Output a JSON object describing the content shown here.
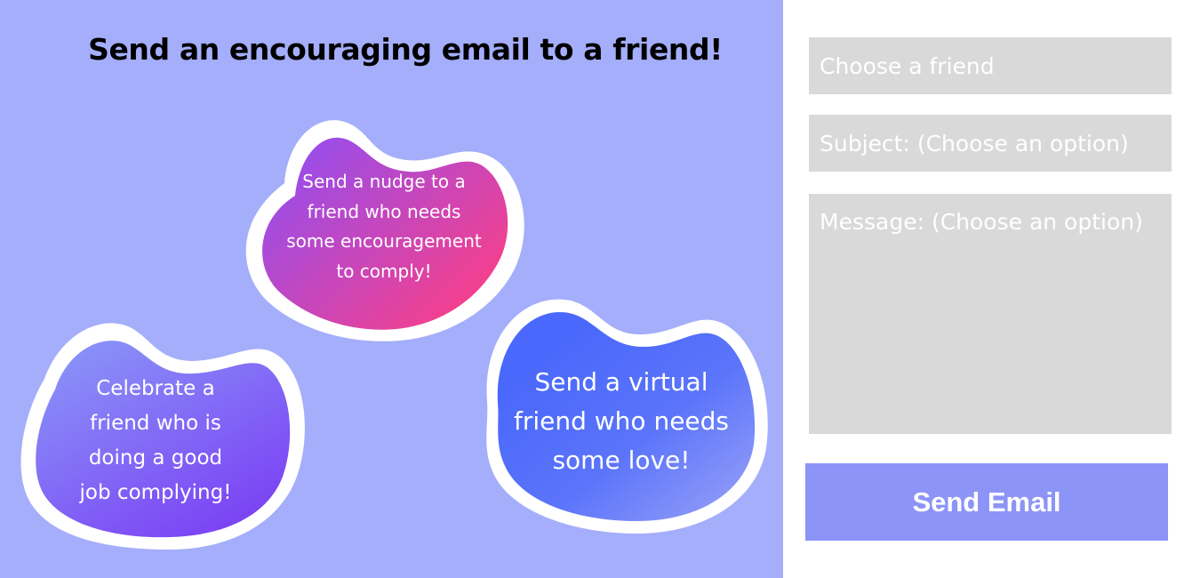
{
  "header": {
    "title": "Send an encouraging email to a friend!"
  },
  "options": {
    "nudge": {
      "lines": [
        "Send a nudge to a",
        "friend who needs",
        "some encouragement",
        "to comply!"
      ]
    },
    "celebrate": {
      "lines": [
        "Celebrate a",
        "friend who is",
        "doing a good",
        "job complying!"
      ]
    },
    "love": {
      "lines": [
        "Send a virtual",
        "friend who needs",
        "some love!"
      ]
    }
  },
  "form": {
    "friend_placeholder": "Choose a friend",
    "subject_placeholder": "Subject: (Choose an option)",
    "message_placeholder": "Message: (Choose an option)",
    "send_label": "Send Email"
  },
  "colors": {
    "panel_background": "#a5aefa",
    "field_background": "#d9d9d9",
    "button_background": "#8c94f7",
    "nudge_gradient": [
      "#8a4ff8",
      "#fb3f86"
    ],
    "celebrate_gradient": [
      "#8a96f8",
      "#7b3ff4"
    ],
    "love_gradient": [
      "#4a68fb",
      "#8c98f8"
    ]
  }
}
